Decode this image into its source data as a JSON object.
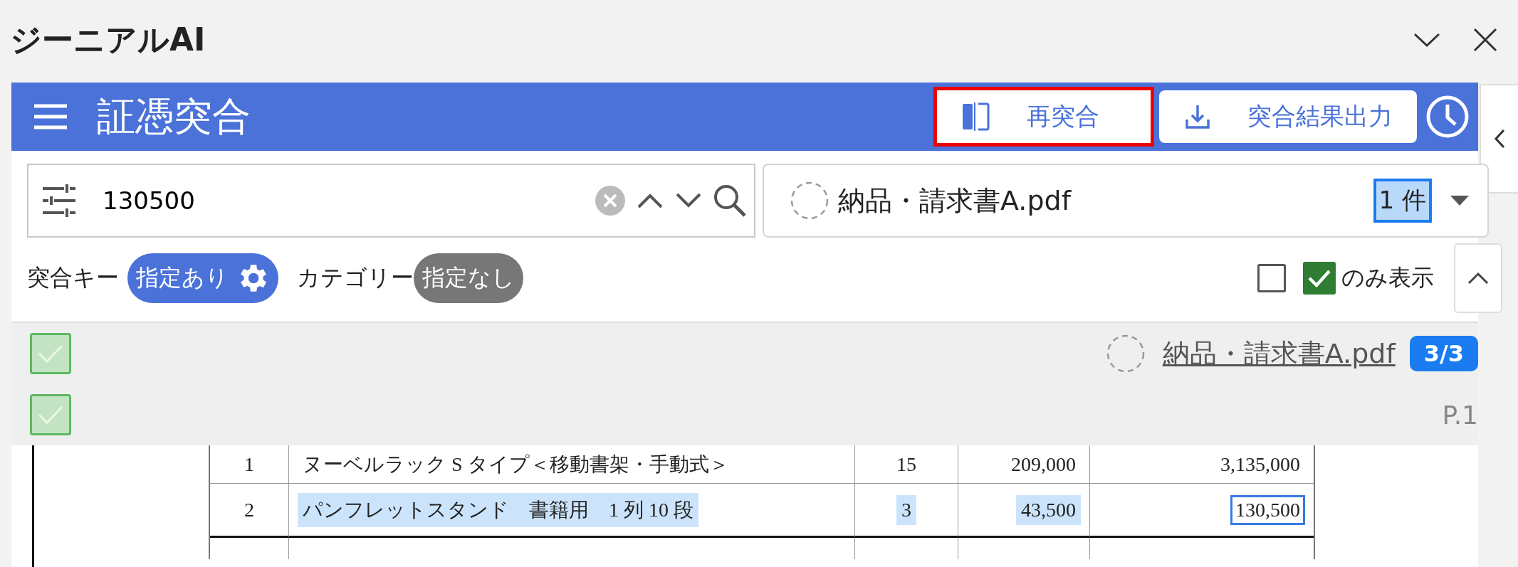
{
  "window": {
    "title": "ジーニアルAI"
  },
  "header": {
    "title": "証憑突合",
    "buttons": [
      {
        "label": "再突合",
        "kind": "rematch",
        "highlighted": true
      },
      {
        "label": "突合結果出力",
        "kind": "export",
        "highlighted": false
      }
    ]
  },
  "search": {
    "value": "130500"
  },
  "file_select": {
    "name": "納品・請求書A.pdf",
    "count": "1 件",
    "count_selected": true
  },
  "filters": [
    {
      "label": "突合キー",
      "chip": "指定あり",
      "kind": "set"
    },
    {
      "label": "カテゴリー",
      "chip": "指定なし",
      "kind": "unset"
    }
  ],
  "filter_checkbox": {
    "checked": false
  },
  "only_show": {
    "checked": true,
    "label": "のみ表示"
  },
  "result": {
    "file": "納品・請求書A.pdf",
    "badge": "3/3",
    "page": "P.1",
    "row_checks": [
      {
        "checked": true
      },
      {
        "checked": true
      }
    ]
  },
  "document": {
    "rows": [
      {
        "cells": [
          {
            "text": "1",
            "selected": false,
            "focused": false
          },
          {
            "text": "ヌーベルラック S タイプ＜移動書架・手動式＞",
            "selected": false,
            "focused": false
          },
          {
            "text": "15",
            "selected": false,
            "focused": false
          },
          {
            "text": "209,000",
            "selected": false,
            "focused": false
          },
          {
            "text": "3,135,000",
            "selected": false,
            "focused": false
          }
        ]
      },
      {
        "cells": [
          {
            "text": "2",
            "selected": false,
            "focused": false
          },
          {
            "text": "パンフレットスタンド　書籍用　1 列 10 段",
            "selected": true,
            "focused": false
          },
          {
            "text": "3",
            "selected": true,
            "focused": false
          },
          {
            "text": "43,500",
            "selected": true,
            "focused": false
          },
          {
            "text": "130,500",
            "selected": false,
            "focused": true
          }
        ]
      }
    ]
  }
}
